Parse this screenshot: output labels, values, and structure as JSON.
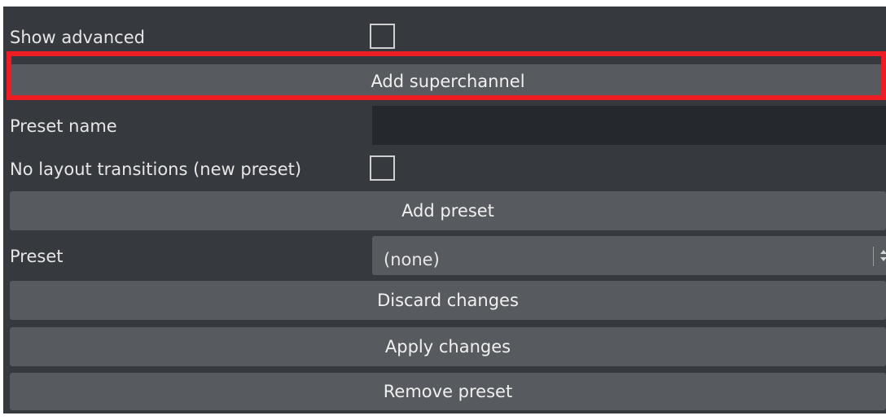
{
  "show_advanced": {
    "label": "Show advanced",
    "checked": false
  },
  "add_superchannel": {
    "label": "Add superchannel",
    "highlight_color": "#ee1c25"
  },
  "preset_name": {
    "label": "Preset name",
    "value": ""
  },
  "no_layout_transitions": {
    "label": "No layout transitions (new preset)",
    "checked": false
  },
  "add_preset": {
    "label": "Add preset"
  },
  "preset": {
    "label": "Preset",
    "selected": "(none)"
  },
  "discard_changes": {
    "label": "Discard changes"
  },
  "apply_changes": {
    "label": "Apply changes"
  },
  "remove_preset": {
    "label": "Remove preset"
  },
  "colors": {
    "panel_background": "#363a3f",
    "button_background": "#575b5f",
    "input_background": "#25282c",
    "text": "#e6e6e6"
  }
}
